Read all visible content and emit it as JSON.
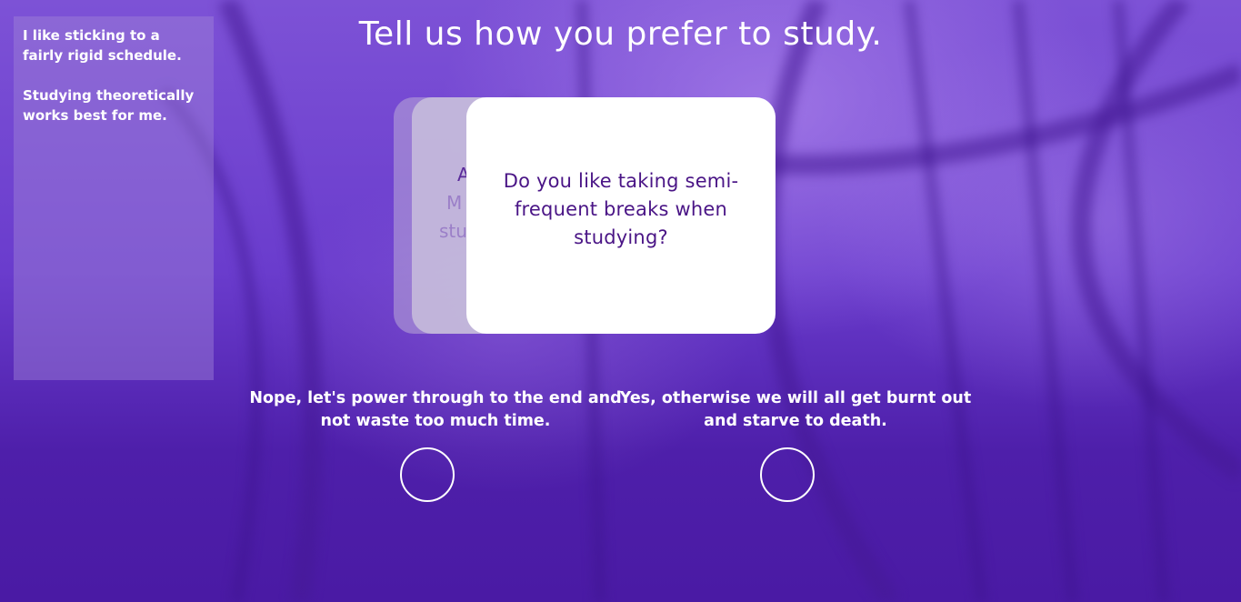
{
  "page": {
    "title": "Tell us how you prefer to study."
  },
  "sidebar": {
    "answers": [
      "I like sticking to a fairly rigid schedule.",
      "Studying theoretically works best for me."
    ]
  },
  "cards": {
    "peek_lines": [
      "A",
      "M",
      "stu"
    ],
    "current_question": "Do you like taking semi-frequent breaks when studying?"
  },
  "options": {
    "no_label": "Nope, let's power through to the end and not waste too much time.",
    "yes_label": "Yes, otherwise we will all get burnt out and starve to death."
  },
  "colors": {
    "background": "#5a2cc0",
    "question_text": "#4a1586",
    "card": "#ffffff"
  }
}
